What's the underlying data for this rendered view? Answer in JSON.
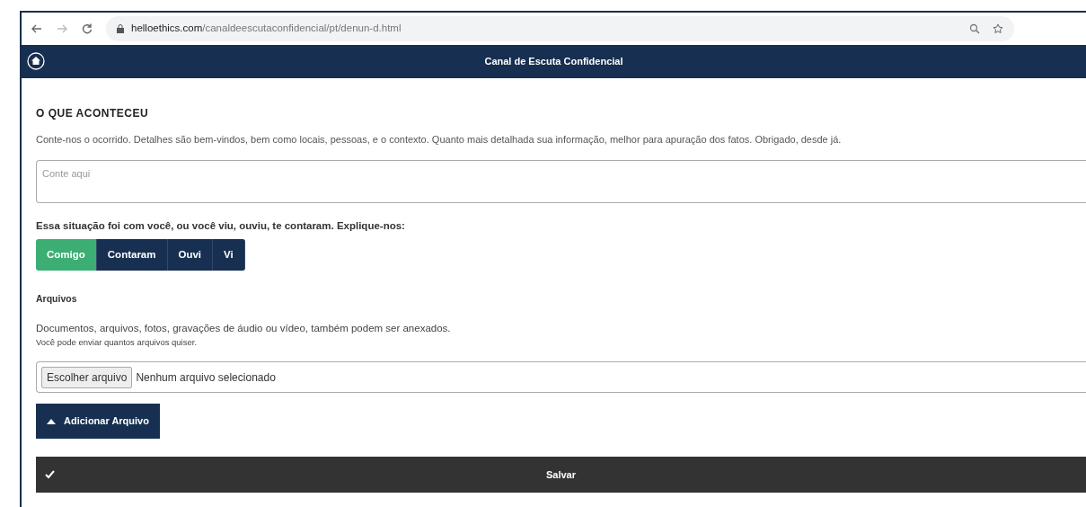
{
  "browser": {
    "url_host": "helloethics.com",
    "url_path": "/canaldeescutaconfidencial/pt/denun-d.html"
  },
  "header": {
    "title": "Canal de Escuta Confidencial"
  },
  "section": {
    "title": "O QUE ACONTECEU",
    "description": "Conte-nos o ocorrido. Detalhes são bem-vindos, bem como locais, pessoas, e o contexto. Quanto mais detalhada sua informação, melhor para apuração dos fatos. Obrigado, desde já.",
    "placeholder": "Conte aqui"
  },
  "question": {
    "label": "Essa situação foi com você, ou você viu, ouviu, te contaram. Explique-nos:",
    "options": [
      {
        "label": "Comigo",
        "selected": true
      },
      {
        "label": "Contaram",
        "selected": false
      },
      {
        "label": "Ouvi",
        "selected": false
      },
      {
        "label": "Vi",
        "selected": false
      }
    ]
  },
  "files": {
    "title": "Arquivos",
    "description": "Documentos, arquivos, fotos, gravações de áudio ou vídeo, também podem ser anexados.",
    "note": "Você pode enviar quantos arquivos quiser.",
    "choose_button": "Escolher arquivo",
    "status": "Nenhum arquivo selecionado",
    "add_button": "Adicionar Arquivo"
  },
  "save_button": "Salvar"
}
